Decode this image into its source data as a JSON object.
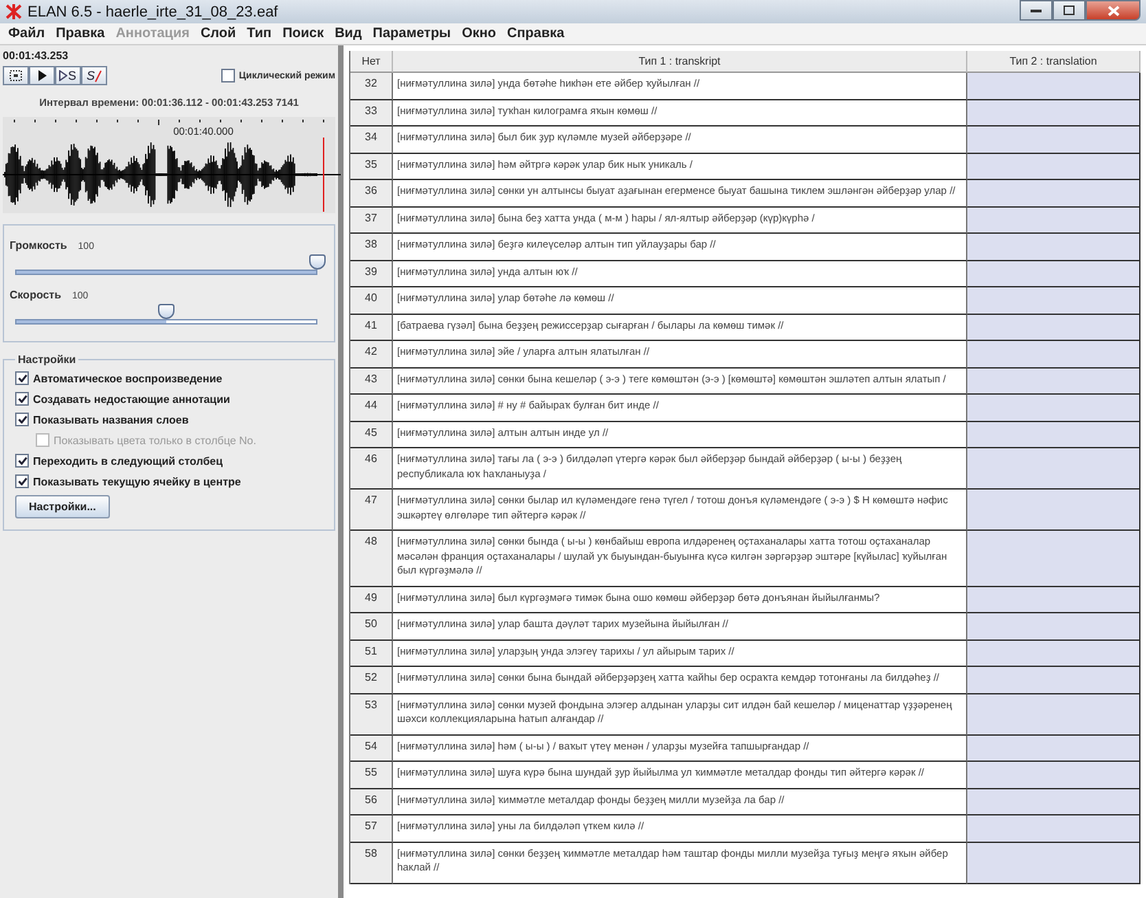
{
  "window": {
    "title": "ELAN 6.5 - haerle_irte_31_08_23.eaf"
  },
  "menu": [
    {
      "label": "Файл",
      "disabled": false
    },
    {
      "label": "Правка",
      "disabled": false
    },
    {
      "label": "Аннотация",
      "disabled": true
    },
    {
      "label": "Слой",
      "disabled": false
    },
    {
      "label": "Тип",
      "disabled": false
    },
    {
      "label": "Поиск",
      "disabled": false
    },
    {
      "label": "Вид",
      "disabled": false
    },
    {
      "label": "Параметры",
      "disabled": false
    },
    {
      "label": "Окно",
      "disabled": false
    },
    {
      "label": "Справка",
      "disabled": false
    }
  ],
  "player": {
    "time": "00:01:43.253",
    "buttons": [
      {
        "kind": "selection"
      },
      {
        "kind": "play"
      },
      {
        "kind": "play-s",
        "label": "S"
      },
      {
        "kind": "s-off",
        "label": "S"
      }
    ],
    "loop": {
      "label": "Циклический режим",
      "checked": false
    },
    "interval": "Интервал времени: 00:01:36.112 - 00:01:43.253  7141",
    "ruler_label": "00:01:40.000"
  },
  "sliders": [
    {
      "label": "Громкость",
      "value": "100",
      "level": 1.0
    },
    {
      "label": "Скорость",
      "value": "100",
      "level": 0.5
    }
  ],
  "settings": {
    "title": "Настройки",
    "options": [
      {
        "label": "Автоматическое воспроизведение",
        "checked": true,
        "disabled": false
      },
      {
        "label": "Создавать недостающие аннотации",
        "checked": true,
        "disabled": false
      },
      {
        "label": "Показывать названия слоев",
        "checked": true,
        "disabled": false,
        "children": [
          {
            "label": "Показывать цвета только в столбце No.",
            "checked": false,
            "disabled": true
          }
        ]
      },
      {
        "label": "Переходить в следующий столбец",
        "checked": true,
        "disabled": false
      },
      {
        "label": "Показывать текущую ячейку в центре",
        "checked": true,
        "disabled": false
      }
    ],
    "button": "Настройки..."
  },
  "table": {
    "columns": [
      "Нет",
      "Тип 1 : transkript",
      "Тип 2 : translation"
    ],
    "rows": [
      {
        "no": "32",
        "text": "[ниғмәтуллина зилә] унда бөтәһе һикһән ете әйбер ҡуйылған //"
      },
      {
        "no": "33",
        "text": "[ниғмәтуллина зилә] туҡһан килограмға яҡын көмөш //"
      },
      {
        "no": "34",
        "text": "[ниғмәтуллина зилә] был бик ҙур күләмле музей әйберҙәре //"
      },
      {
        "no": "35",
        "text": "[ниғмәтуллина зилә] һәм әйтргә кәрәк улар бик ныҡ уникаль /"
      },
      {
        "no": "36",
        "text": "[ниғмәтуллина зилә] сөнки ун алтынсы быуат аҙағынан егерменсе быуат башына тиклем эшләнгән әйберҙәр улар //"
      },
      {
        "no": "37",
        "text": "[ниғмәтуллина зилә] бына беҙ хатта унда ( м-м ) һары / ял-ялтыр әйберҙәр (күр)күрһә /"
      },
      {
        "no": "38",
        "text": "[ниғмәтуллина зилә] беҙгә килеүселәр алтын тип уйлауҙары бар //"
      },
      {
        "no": "39",
        "text": "[ниғмәтуллина зилә] унда алтын юҡ //"
      },
      {
        "no": "40",
        "text": "[ниғмәтуллина зилә] улар бөтәһе лә көмөш //"
      },
      {
        "no": "41",
        "text": "[батраева гүзәл] бына беҙҙең режиссерҙар сығарған / былары ла көмөш тимәк //"
      },
      {
        "no": "42",
        "text": "[ниғмәтуллина зилә] эйе / уларға алтын ялатылған //"
      },
      {
        "no": "43",
        "text": "[ниғмәтуллина зилә] сөнки бына кешеләр ( э-э ) теге көмөштән (э-э ) [көмөштә] көмөштән эшләтеп алтын ялатып /"
      },
      {
        "no": "44",
        "text": "[ниғмәтуллина зилә] # ну # байыраҡ булған бит инде //"
      },
      {
        "no": "45",
        "text": "[ниғмәтуллина зилә] алтын алтын инде ул //"
      },
      {
        "no": "46",
        "text": "[ниғмәтуллина зилә] тағы ла ( э-э ) билдәләп үтергә кәрәк был әйберҙәр бындай әйберҙәр ( ы-ы ) беҙҙең республикала юҡ һаҡланыуҙа /"
      },
      {
        "no": "47",
        "text": "[ниғмәтуллина зилә] сөнки былар ил күләмендәге генә түгел / тотош донъя күләмендәге ( э-э ) $ H көмөштә нәфис эшкәртеү өлгөләре тип әйтергә кәрәк //"
      },
      {
        "no": "48",
        "text": "[ниғмәтуллина зилә] сөнки бында ( ы-ы ) көнбайыш европа илдәренең оҫтаханалары хатта тотош оҫтаханалар мәсәлән франция оҫтаханалары / шулай уҡ быуындан-быуынға күсә килгән зәргәрҙәр эштәре [күйылас] ҡуйылған был күргәҙмәлә //"
      },
      {
        "no": "49",
        "text": "[ниғмәтуллина зилә] был күргәҙмәгә тимәк бына ошо көмөш әйберҙәр бөтә донъянан йыйылғанмы?"
      },
      {
        "no": "50",
        "text": "[ниғмәтуллина зилә] улар башта дәүләт тарих музейына йыйылған //"
      },
      {
        "no": "51",
        "text": "[ниғмәтуллина зилә] уларҙың унда элэгеү тарихы / ул айырым тарих //"
      },
      {
        "no": "52",
        "text": "[ниғмәтуллина зилә] сөнки бына бындай әйберҙәрҙең хатта ҡайһы бер осраҡта кемдәр тотонғаны ла билдәһеҙ //"
      },
      {
        "no": "53",
        "text": "[ниғмәтуллина зилә] сөнки музей фондына элэгер алдынан уларҙы сит илдән бай кешеләр / миценаттар үҙҙәренең шәхси коллекцияларына һатып алғандар //"
      },
      {
        "no": "54",
        "text": "[ниғмәтуллина зилә] һәм ( ы-ы ) / ваҡыт үтеү менән / уларҙы музейға тапшырғандар //"
      },
      {
        "no": "55",
        "text": "[ниғмәтуллина зилә] шуға күрә бына шундай ҙур йыйылма ул ҡиммәтле металдар фонды тип әйтергә кәрәк //"
      },
      {
        "no": "56",
        "text": "[ниғмәтуллина зилә] ҡиммәтле металдар фонды беҙҙең милли музейҙа ла бар //"
      },
      {
        "no": "57",
        "text": "[ниғмәтуллина зилә] уны ла билдәләп үткем килә //"
      },
      {
        "no": "58",
        "text": "[ниғмәтуллина зилә] сөнки беҙҙең ҡиммәтле металдар һәм таштар фонды милли музейҙа туғыҙ меңгә яҡын әйбер һаклай //"
      }
    ]
  }
}
